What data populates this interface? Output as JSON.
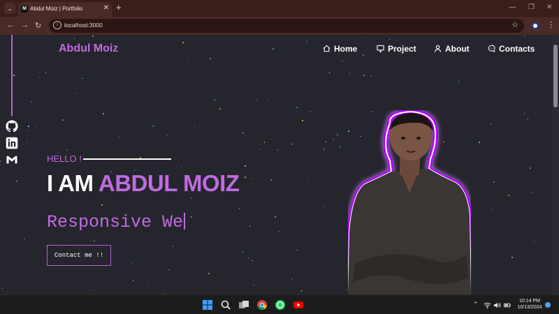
{
  "browser": {
    "tab_title": "Abdul Moiz | Portfolio",
    "tab_favicon": "M",
    "url": "localhost:3000",
    "icons": [
      "tab-list-icon",
      "close-icon",
      "new-tab-icon",
      "minimize-icon",
      "restore-icon",
      "window-close-icon",
      "back-icon",
      "forward-icon",
      "reload-icon",
      "site-info-icon",
      "bookmark-star-icon",
      "profile-icon",
      "menu-dots-icon"
    ]
  },
  "site": {
    "brand": "Abdul Moiz",
    "nav": [
      {
        "label": "Home",
        "icon": "home-icon"
      },
      {
        "label": "Project",
        "icon": "monitor-icon"
      },
      {
        "label": "About",
        "icon": "user-icon"
      },
      {
        "label": "Contacts",
        "icon": "chat-icon"
      }
    ],
    "socials": [
      "github-icon",
      "linkedin-icon",
      "gmail-icon"
    ],
    "hero": {
      "hello": "HELLO !",
      "headline_prefix": "I AM ",
      "headline_name": "ABDUL MOIZ",
      "typed_text": "Responsive We",
      "cta": "Contact me !!"
    },
    "colors": {
      "accent": "#c06be0",
      "background": "#25252d",
      "glow": "#b100ff"
    }
  },
  "taskbar": {
    "apps": [
      "windows-start-icon",
      "search-icon",
      "task-view-icon",
      "chrome-icon",
      "whatsapp-icon",
      "youtube-icon"
    ],
    "tray": [
      "chevron-up-icon",
      "wifi-icon",
      "volume-icon",
      "battery-icon"
    ],
    "time": "10:14 PM",
    "date": "10/13/2024"
  }
}
